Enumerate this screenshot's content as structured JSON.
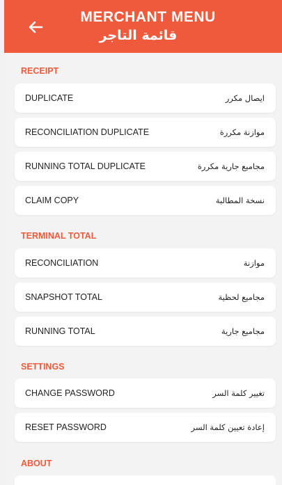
{
  "header": {
    "title_en": "MERCHANT MENU",
    "title_ar": "قائمة التاجر"
  },
  "sections": {
    "receipt": {
      "title": "RECEIPT",
      "items": [
        {
          "en": "DUPLICATE",
          "ar": "ايصال مكرر"
        },
        {
          "en": "RECONCILIATION DUPLICATE",
          "ar": "موازنة مكررة"
        },
        {
          "en": "RUNNING TOTAL DUPLICATE",
          "ar": "مجاميع جارية مكررة"
        },
        {
          "en": "CLAIM COPY",
          "ar": "نسخة المطالبة"
        }
      ]
    },
    "terminal_total": {
      "title": "TERMINAL TOTAL",
      "items": [
        {
          "en": "RECONCILIATION",
          "ar": "موازنة"
        },
        {
          "en": "SNAPSHOT TOTAL",
          "ar": "مجاميع لحظية"
        },
        {
          "en": "RUNNING TOTAL",
          "ar": "مجاميع جارية"
        }
      ]
    },
    "settings": {
      "title": "SETTINGS",
      "items": [
        {
          "en": "CHANGE PASSWORD",
          "ar": "تغيير كلمة السر"
        },
        {
          "en": "RESET PASSWORD",
          "ar": "إعادة تعيين كلمة السر"
        }
      ]
    },
    "about": {
      "title": "ABOUT"
    }
  },
  "icons": {
    "back": "arrow-left-icon"
  },
  "colors": {
    "accent": "#f05a3c",
    "background": "#f3f3f3",
    "card": "#ffffff"
  }
}
